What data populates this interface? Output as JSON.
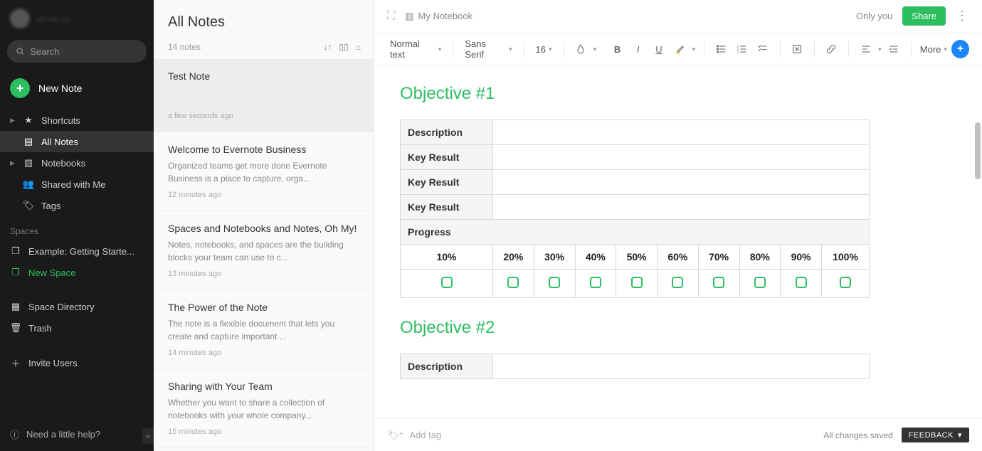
{
  "sidebar": {
    "search_placeholder": "Search",
    "new_note": "New Note",
    "items": [
      {
        "label": "Shortcuts"
      },
      {
        "label": "All Notes"
      },
      {
        "label": "Notebooks"
      },
      {
        "label": "Shared with Me"
      },
      {
        "label": "Tags"
      }
    ],
    "section_spaces": "Spaces",
    "spaces": [
      {
        "label": "Example: Getting Starte..."
      },
      {
        "label": "New Space"
      }
    ],
    "space_directory": "Space Directory",
    "trash": "Trash",
    "invite": "Invite Users",
    "help": "Need a little help?"
  },
  "notelist": {
    "title": "All Notes",
    "count": "14 notes",
    "items": [
      {
        "title": "Test Note",
        "preview": "",
        "time": "a few seconds ago"
      },
      {
        "title": "Welcome to Evernote Business",
        "preview": "Organized teams get more done Evernote Business is a place to capture, orga...",
        "time": "12 minutes ago"
      },
      {
        "title": "Spaces and Notebooks and Notes, Oh My!",
        "preview": "Notes, notebooks, and spaces are the building blocks your team can use to c...",
        "time": "13 minutes ago"
      },
      {
        "title": "The Power of the Note",
        "preview": "The note is a flexible document that lets you create and capture important ...",
        "time": "14 minutes ago"
      },
      {
        "title": "Sharing with Your Team",
        "preview": "Whether you want to share a collection of notebooks with your whole company...",
        "time": "15 minutes ago"
      }
    ]
  },
  "editor": {
    "notebook": "My Notebook",
    "only_you": "Only you",
    "share": "Share",
    "style": "Normal text",
    "font": "Sans Serif",
    "size": "16",
    "more": "More",
    "objective1": "Objective #1",
    "objective2": "Objective #2",
    "row_labels": [
      "Description",
      "Key Result",
      "Key Result",
      "Key Result"
    ],
    "progress": "Progress",
    "percents": [
      "10%",
      "20%",
      "30%",
      "40%",
      "50%",
      "60%",
      "70%",
      "80%",
      "90%",
      "100%"
    ],
    "row2_label": "Description",
    "tag_placeholder": "Add tag",
    "saved": "All changes saved",
    "feedback": "FEEDBACK"
  }
}
